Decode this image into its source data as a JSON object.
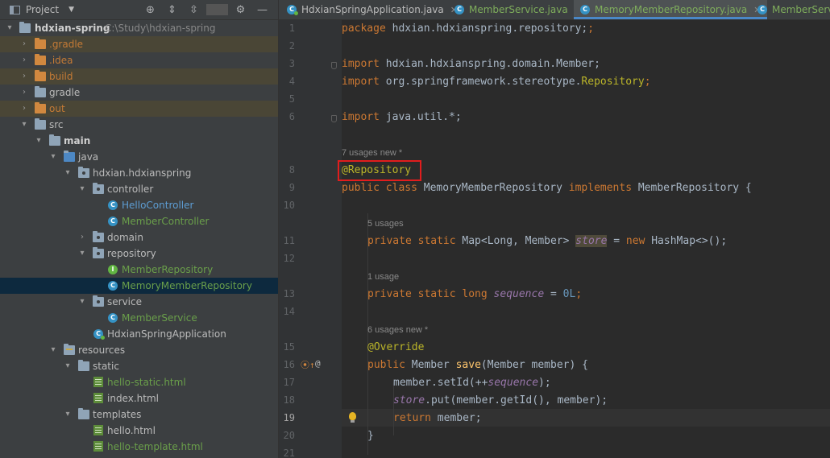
{
  "project_panel": {
    "title": "Project",
    "icons": [
      "crosshair-icon",
      "expand-all-icon",
      "collapse-all-icon",
      "gear-icon",
      "minimize-icon"
    ],
    "root": {
      "name": "hdxian-spring",
      "path": "C:\\Study\\hdxian-spring"
    },
    "items": [
      {
        "label": ".gradle"
      },
      {
        "label": ".idea"
      },
      {
        "label": "build"
      },
      {
        "label": "gradle"
      },
      {
        "label": "out"
      },
      {
        "label": "src"
      },
      {
        "label": "main"
      },
      {
        "label": "java"
      },
      {
        "label": "hdxian.hdxianspring"
      },
      {
        "label": "controller"
      },
      {
        "label": "HelloController"
      },
      {
        "label": "MemberController"
      },
      {
        "label": "domain"
      },
      {
        "label": "repository"
      },
      {
        "label": "MemberRepository"
      },
      {
        "label": "MemoryMemberRepository"
      },
      {
        "label": "service"
      },
      {
        "label": "MemberService"
      },
      {
        "label": "HdxianSpringApplication"
      },
      {
        "label": "resources"
      },
      {
        "label": "static"
      },
      {
        "label": "hello-static.html"
      },
      {
        "label": "index.html"
      },
      {
        "label": "templates"
      },
      {
        "label": "hello.html"
      },
      {
        "label": "hello-template.html"
      }
    ]
  },
  "tabs": [
    {
      "label": "HdxianSpringApplication.java"
    },
    {
      "label": "MemberService.java"
    },
    {
      "label": "MemoryMemberRepository.java"
    },
    {
      "label": "MemberServi"
    }
  ],
  "editor": {
    "current_line": 19,
    "hints": {
      "class": "7 usages   new *",
      "store": "5 usages",
      "sequence": "1 usage",
      "save": "6 usages   new *"
    },
    "code": {
      "l1_kw": "package",
      "l1_rest": " hdxian.hdxianspring.repository;",
      "l3_kw": "import",
      "l3_rest": " hdxian.hdxianspring.domain.Member;",
      "l4_kw": "import",
      "l4_mid": " org.springframework.stereotype.",
      "l4_ann": "Repository",
      "l4_end": ";",
      "l6_kw": "import",
      "l6_rest": " java.util.*;",
      "l8": "@Repository",
      "l9_kw1": "public class",
      "l9_name": " MemoryMemberRepository ",
      "l9_kw2": "implements",
      "l9_rest": " MemberRepository {",
      "l11_kw": "private static",
      "l11_type": " Map<Long, Member> ",
      "l11_field": "store",
      "l11_eq": " = ",
      "l11_new": "new",
      "l11_rest": " HashMap<>();",
      "l13_kw": "private static long",
      "l13_sp": " ",
      "l13_field": "sequence",
      "l13_eq": " = ",
      "l13_num": "0L",
      "l13_end": ";",
      "l15": "@Override",
      "l16_kw": "public",
      "l16_type": " Member ",
      "l16_fn": "save",
      "l16_rest": "(Member member) {",
      "l17_a": "member.setId(++",
      "l17_field": "sequence",
      "l17_b": ");",
      "l18_field": "store",
      "l18_rest": ".put(member.getId(), member);",
      "l19_kw": "return",
      "l19_rest": " member;",
      "l20": "}"
    },
    "line_numbers": [
      "1",
      "2",
      "3",
      "4",
      "5",
      "6",
      "8",
      "9",
      "10",
      "11",
      "12",
      "13",
      "14",
      "15",
      "16",
      "17",
      "18",
      "19",
      "20",
      "21"
    ]
  },
  "colors": {
    "annotation_box": "#e11d1d",
    "selection": "#0d293e"
  }
}
